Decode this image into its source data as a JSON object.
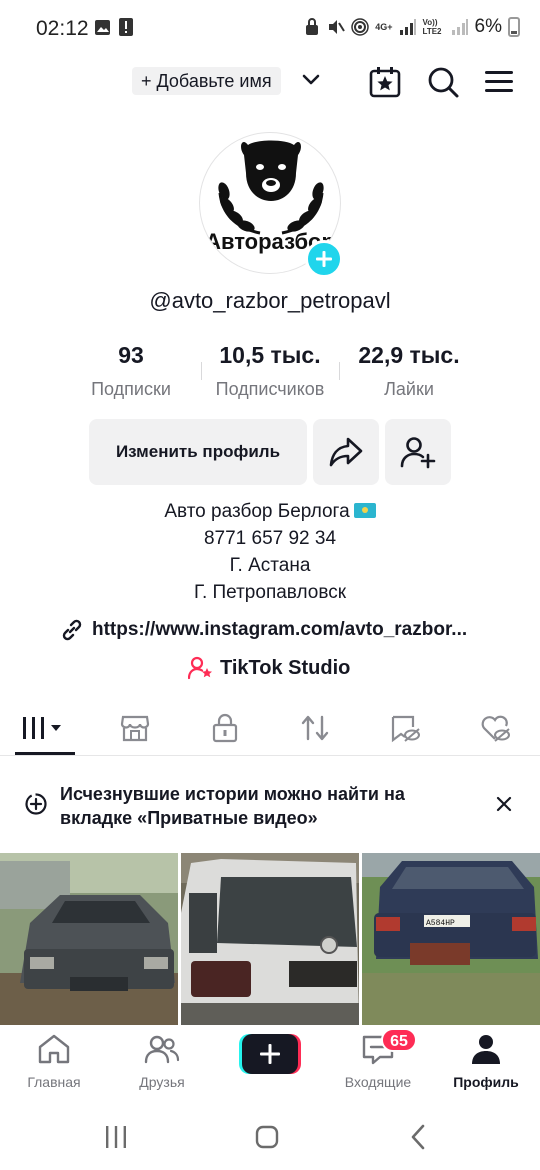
{
  "status_bar": {
    "time": "02:12",
    "battery": "6%",
    "net_label": "4G+",
    "volte_label": "Vo)) LTE2"
  },
  "header": {
    "name_chip": "+ Добавьте имя"
  },
  "profile": {
    "avatar_text": "Авторазбор",
    "username": "@avto_razbor_petropavl",
    "stats": [
      {
        "value": "93",
        "label": "Подписки"
      },
      {
        "value": "10,5 тыс.",
        "label": "Подписчиков"
      },
      {
        "value": "22,9 тыс.",
        "label": "Лайки"
      }
    ],
    "edit_button": "Изменить профиль",
    "bio": [
      "Авто разбор Берлога",
      "8771 657 92 34",
      "Г. Астана",
      "Г. Петропавловск"
    ],
    "link": "https://www.instagram.com/avto_razbor...",
    "studio": "TikTok Studio"
  },
  "notice": {
    "text": "Исчезнувшие истории можно найти на вкладке «Приватные видео»"
  },
  "thumb_plates": [
    "A584HP"
  ],
  "bottom_nav": {
    "home": "Главная",
    "friends": "Друзья",
    "inbox": "Входящие",
    "inbox_badge": "65",
    "profile": "Профиль"
  },
  "colors": {
    "accent_cyan": "#20d5ec",
    "accent_red": "#fe2c55",
    "text": "#161823",
    "muted": "#75767c"
  }
}
